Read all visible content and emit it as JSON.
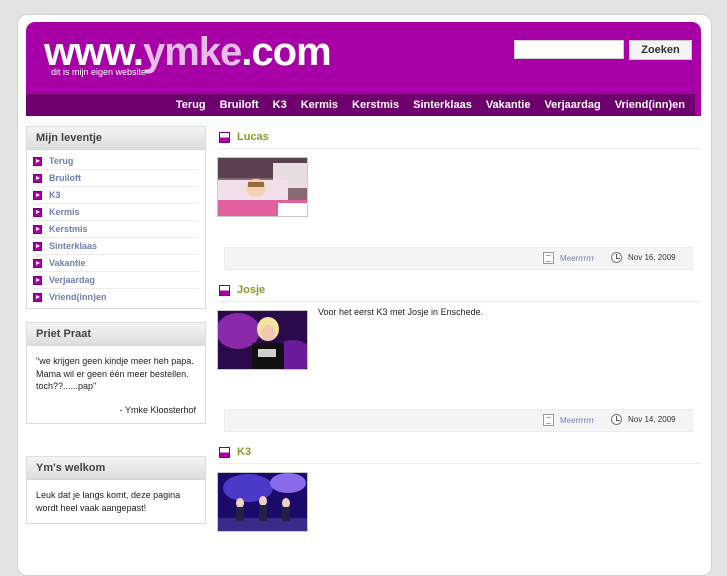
{
  "header": {
    "logo_prefix": "www.",
    "logo_mid": "ymke",
    "logo_suffix": ".com",
    "tagline": "dit is mijn eigen website",
    "search_placeholder": "",
    "search_button": "Zoeken"
  },
  "nav": [
    "Terug",
    "Bruiloft",
    "K3",
    "Kermis",
    "Kerstmis",
    "Sinterklaas",
    "Vakantie",
    "Verjaardag",
    "Vriend(inn)en"
  ],
  "sidebar": {
    "menu_title": "Mijn leventje",
    "menu_items": [
      "Terug",
      "Bruiloft",
      "K3",
      "Kermis",
      "Kerstmis",
      "Sinterklaas",
      "Vakantie",
      "Verjaardag",
      "Vriend(inn)en"
    ],
    "priet_title": "Priet Praat",
    "priet_quote": "\"we krijgen geen kindje meer heh papa. Mama wil er geen één meer bestellen. toch??......pap\"",
    "priet_author": "- Ymke Kloosterhof",
    "welcome_title": "Ym's welkom",
    "welcome_text": "Leuk dat je langs komt, deze pagina wordt heel vaak aangepast!"
  },
  "posts": [
    {
      "title": "Lucas",
      "text": "",
      "more": "Meerrrrrrr",
      "date": "Nov 16, 2009"
    },
    {
      "title": "Josje",
      "text": "Voor het eerst K3 met Josje in Enschede.",
      "more": "Meerrrrrrr",
      "date": "Nov 14, 2009"
    },
    {
      "title": "K3",
      "text": "",
      "more": "",
      "date": ""
    }
  ],
  "colors": {
    "brand": "#a700a7",
    "nav_bg": "#6d006d",
    "title_green": "#8a9a2a",
    "link_blue": "#6f7fb0"
  }
}
